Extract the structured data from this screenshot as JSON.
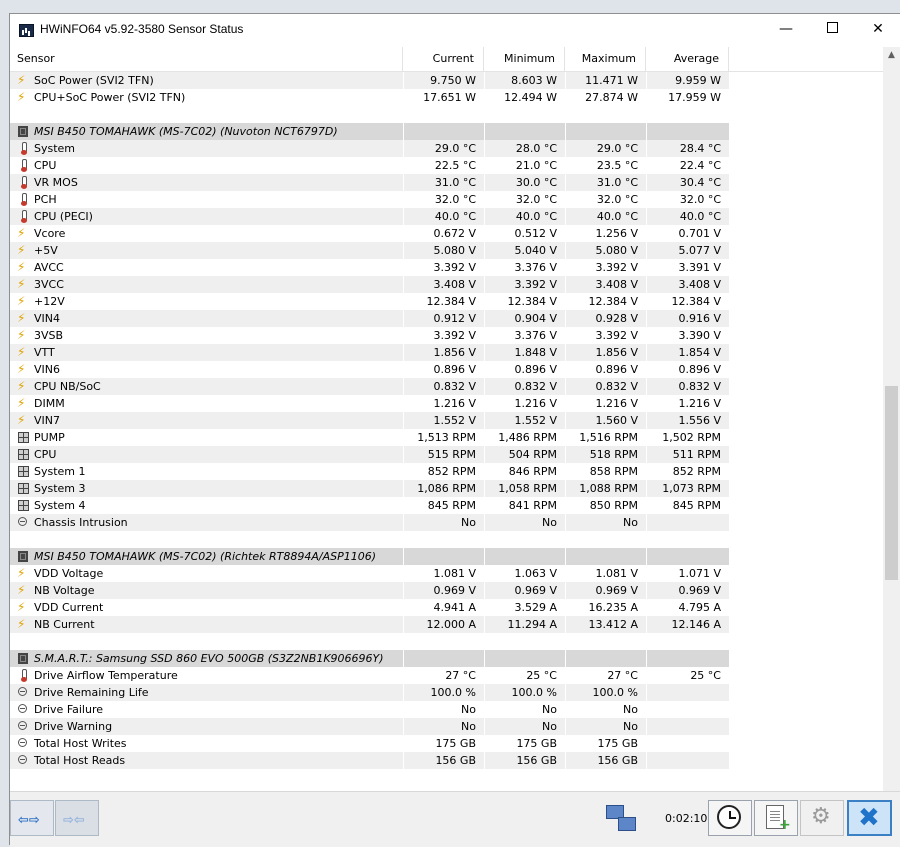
{
  "window": {
    "title": "HWiNFO64 v5.92-3580 Sensor Status",
    "min_glyph": "—",
    "close_glyph": "✕"
  },
  "columns": {
    "sensor": "Sensor",
    "current": "Current",
    "minimum": "Minimum",
    "maximum": "Maximum",
    "average": "Average"
  },
  "rows": [
    {
      "type": "volt",
      "name": "SoC Power (SVI2 TFN)",
      "cur": "9.750 W",
      "min": "8.603 W",
      "max": "11.471 W",
      "avg": "9.959 W"
    },
    {
      "type": "volt",
      "name": "CPU+SoC Power (SVI2 TFN)",
      "cur": "17.651 W",
      "min": "12.494 W",
      "max": "27.874 W",
      "avg": "17.959 W"
    },
    {
      "type": "blank"
    },
    {
      "type": "group",
      "name": "MSI B450 TOMAHAWK (MS-7C02) (Nuvoton NCT6797D)"
    },
    {
      "type": "therm",
      "name": "System",
      "cur": "29.0 °C",
      "min": "28.0 °C",
      "max": "29.0 °C",
      "avg": "28.4 °C"
    },
    {
      "type": "therm",
      "name": "CPU",
      "cur": "22.5 °C",
      "min": "21.0 °C",
      "max": "23.5 °C",
      "avg": "22.4 °C"
    },
    {
      "type": "therm",
      "name": "VR MOS",
      "cur": "31.0 °C",
      "min": "30.0 °C",
      "max": "31.0 °C",
      "avg": "30.4 °C"
    },
    {
      "type": "therm",
      "name": "PCH",
      "cur": "32.0 °C",
      "min": "32.0 °C",
      "max": "32.0 °C",
      "avg": "32.0 °C"
    },
    {
      "type": "therm",
      "name": "CPU (PECI)",
      "cur": "40.0 °C",
      "min": "40.0 °C",
      "max": "40.0 °C",
      "avg": "40.0 °C"
    },
    {
      "type": "volt",
      "name": "Vcore",
      "cur": "0.672 V",
      "min": "0.512 V",
      "max": "1.256 V",
      "avg": "0.701 V"
    },
    {
      "type": "volt",
      "name": "+5V",
      "cur": "5.080 V",
      "min": "5.040 V",
      "max": "5.080 V",
      "avg": "5.077 V"
    },
    {
      "type": "volt",
      "name": "AVCC",
      "cur": "3.392 V",
      "min": "3.376 V",
      "max": "3.392 V",
      "avg": "3.391 V"
    },
    {
      "type": "volt",
      "name": "3VCC",
      "cur": "3.408 V",
      "min": "3.392 V",
      "max": "3.408 V",
      "avg": "3.408 V"
    },
    {
      "type": "volt",
      "name": "+12V",
      "cur": "12.384 V",
      "min": "12.384 V",
      "max": "12.384 V",
      "avg": "12.384 V"
    },
    {
      "type": "volt",
      "name": "VIN4",
      "cur": "0.912 V",
      "min": "0.904 V",
      "max": "0.928 V",
      "avg": "0.916 V"
    },
    {
      "type": "volt",
      "name": "3VSB",
      "cur": "3.392 V",
      "min": "3.376 V",
      "max": "3.392 V",
      "avg": "3.390 V"
    },
    {
      "type": "volt",
      "name": "VTT",
      "cur": "1.856 V",
      "min": "1.848 V",
      "max": "1.856 V",
      "avg": "1.854 V"
    },
    {
      "type": "volt",
      "name": "VIN6",
      "cur": "0.896 V",
      "min": "0.896 V",
      "max": "0.896 V",
      "avg": "0.896 V"
    },
    {
      "type": "volt",
      "name": "CPU NB/SoC",
      "cur": "0.832 V",
      "min": "0.832 V",
      "max": "0.832 V",
      "avg": "0.832 V"
    },
    {
      "type": "volt",
      "name": "DIMM",
      "cur": "1.216 V",
      "min": "1.216 V",
      "max": "1.216 V",
      "avg": "1.216 V"
    },
    {
      "type": "volt",
      "name": "VIN7",
      "cur": "1.552 V",
      "min": "1.552 V",
      "max": "1.560 V",
      "avg": "1.556 V"
    },
    {
      "type": "fan",
      "name": "PUMP",
      "cur": "1,513 RPM",
      "min": "1,486 RPM",
      "max": "1,516 RPM",
      "avg": "1,502 RPM"
    },
    {
      "type": "fan",
      "name": "CPU",
      "cur": "515 RPM",
      "min": "504 RPM",
      "max": "518 RPM",
      "avg": "511 RPM"
    },
    {
      "type": "fan",
      "name": "System 1",
      "cur": "852 RPM",
      "min": "846 RPM",
      "max": "858 RPM",
      "avg": "852 RPM"
    },
    {
      "type": "fan",
      "name": "System 3",
      "cur": "1,086 RPM",
      "min": "1,058 RPM",
      "max": "1,088 RPM",
      "avg": "1,073 RPM"
    },
    {
      "type": "fan",
      "name": "System 4",
      "cur": "845 RPM",
      "min": "841 RPM",
      "max": "850 RPM",
      "avg": "845 RPM"
    },
    {
      "type": "bool",
      "name": "Chassis Intrusion",
      "cur": "No",
      "min": "No",
      "max": "No",
      "avg": ""
    },
    {
      "type": "blank"
    },
    {
      "type": "group",
      "name": "MSI B450 TOMAHAWK (MS-7C02) (Richtek RT8894A/ASP1106)"
    },
    {
      "type": "volt",
      "name": "VDD Voltage",
      "cur": "1.081 V",
      "min": "1.063 V",
      "max": "1.081 V",
      "avg": "1.071 V"
    },
    {
      "type": "volt",
      "name": "NB Voltage",
      "cur": "0.969 V",
      "min": "0.969 V",
      "max": "0.969 V",
      "avg": "0.969 V"
    },
    {
      "type": "volt",
      "name": "VDD Current",
      "cur": "4.941 A",
      "min": "3.529 A",
      "max": "16.235 A",
      "avg": "4.795 A"
    },
    {
      "type": "volt",
      "name": "NB Current",
      "cur": "12.000 A",
      "min": "11.294 A",
      "max": "13.412 A",
      "avg": "12.146 A"
    },
    {
      "type": "blank"
    },
    {
      "type": "group",
      "name": "S.M.A.R.T.: Samsung SSD 860 EVO 500GB (S3Z2NB1K906696Y)"
    },
    {
      "type": "therm",
      "name": "Drive Airflow Temperature",
      "cur": "27 °C",
      "min": "25 °C",
      "max": "27 °C",
      "avg": "25 °C"
    },
    {
      "type": "bool",
      "name": "Drive Remaining Life",
      "cur": "100.0 %",
      "min": "100.0 %",
      "max": "100.0 %",
      "avg": ""
    },
    {
      "type": "bool",
      "name": "Drive Failure",
      "cur": "No",
      "min": "No",
      "max": "No",
      "avg": ""
    },
    {
      "type": "bool",
      "name": "Drive Warning",
      "cur": "No",
      "min": "No",
      "max": "No",
      "avg": ""
    },
    {
      "type": "bool",
      "name": "Total Host Writes",
      "cur": "175 GB",
      "min": "175 GB",
      "max": "175 GB",
      "avg": ""
    },
    {
      "type": "bool",
      "name": "Total Host Reads",
      "cur": "156 GB",
      "min": "156 GB",
      "max": "156 GB",
      "avg": ""
    },
    {
      "type": "blank"
    }
  ],
  "toolbar": {
    "timer": "0:02:10",
    "nav_left_glyph": "⇦⇨",
    "nav_right_glyph": "⇨⇦",
    "plus_glyph": "+",
    "gear_glyph": "⚙",
    "close_glyph": "✖"
  },
  "scrollbar": {
    "up_glyph": "▲",
    "down_glyph": "▼"
  },
  "colors": {
    "accent": "#1f73c9",
    "group_bg": "#d8d8d8",
    "alt_row_bg": "#efefef"
  }
}
